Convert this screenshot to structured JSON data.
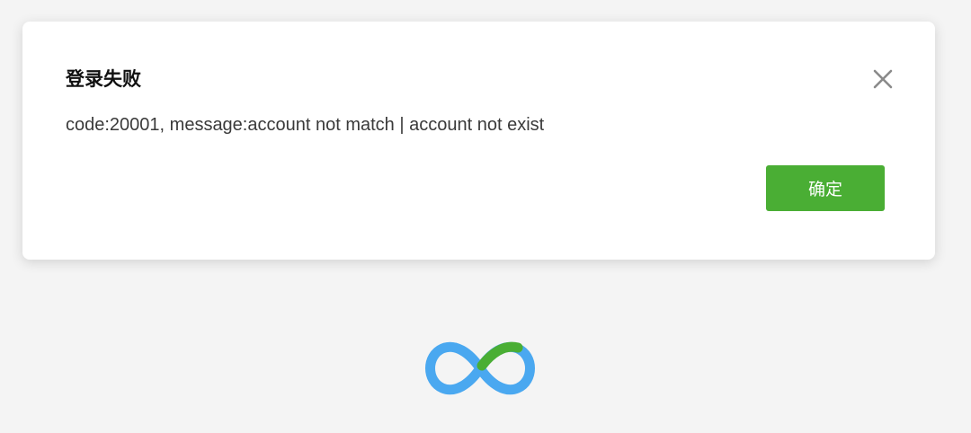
{
  "dialog": {
    "title": "登录失败",
    "message": "code:20001, message:account not match | account not exist",
    "confirm_label": "确定",
    "close_icon": "close-icon"
  },
  "logo": {
    "icon": "infinity-logo-icon",
    "colors": {
      "primary": "#4aa8f0",
      "accent": "#4aae34"
    }
  },
  "colors": {
    "background": "#f4f4f4",
    "dialog_background": "#ffffff",
    "button": "#4aae34",
    "title_text": "#111111",
    "message_text": "#3a3a3a",
    "close_icon": "#8a8a8a"
  }
}
